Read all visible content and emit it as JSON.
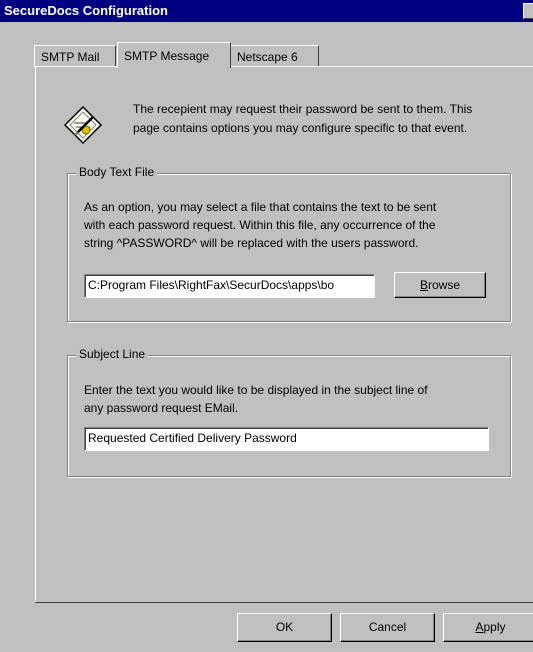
{
  "window": {
    "title": "SecureDocs Configuration"
  },
  "tabs": [
    {
      "label": "SMTP Mail"
    },
    {
      "label": "SMTP Message"
    },
    {
      "label": "Netscape 6"
    }
  ],
  "intro": {
    "line1": "The recepient may request their password be sent to them. This",
    "line2": "page contains options you may configure specific to that event."
  },
  "body_text_file": {
    "caption": "Body Text File",
    "line1": "As an option, you may select a file that contains the text to be sent",
    "line2": "with each password request. Within this file, any occurrence of the",
    "line3": "string ^PASSWORD^ will be replaced with the users password.",
    "path_value": "C:Program Files\\RightFax\\SecurDocs\\apps\\bo",
    "browse_label": "Browse",
    "browse_mnemonic": "B",
    "browse_rest": "rowse"
  },
  "subject_line": {
    "caption": "Subject Line",
    "line1": "Enter the text you would like to be displayed in the subject line of",
    "line2": "any password request EMail.",
    "value": "Requested Certified Delivery Password"
  },
  "buttons": {
    "ok": "OK",
    "cancel": "Cancel",
    "apply_mnemonic": "A",
    "apply_rest": "pply"
  }
}
